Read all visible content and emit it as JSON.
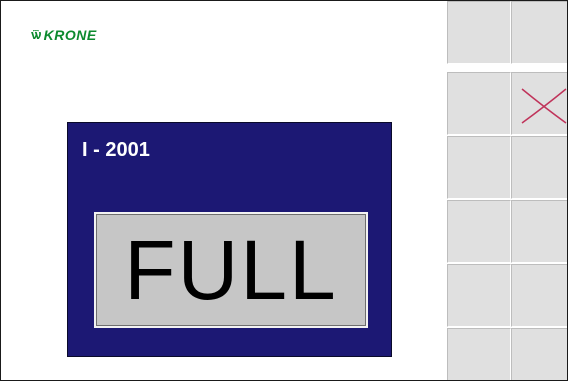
{
  "brand": {
    "logo_text": "KRONE",
    "logo_mark": "ѿ"
  },
  "alarm": {
    "code": "I - 2001",
    "status": "FULL"
  },
  "softkeys": [
    {
      "id": "key-1",
      "icon": ""
    },
    {
      "id": "key-2",
      "icon": ""
    },
    {
      "id": "key-3",
      "icon": ""
    },
    {
      "id": "key-4",
      "icon": "close-icon"
    },
    {
      "id": "key-5",
      "icon": ""
    },
    {
      "id": "key-6",
      "icon": ""
    },
    {
      "id": "key-7",
      "icon": ""
    },
    {
      "id": "key-8",
      "icon": ""
    },
    {
      "id": "key-9",
      "icon": ""
    },
    {
      "id": "key-10",
      "icon": ""
    },
    {
      "id": "key-11",
      "icon": ""
    },
    {
      "id": "key-12",
      "icon": ""
    }
  ],
  "colors": {
    "panel_bg": "#1c1874",
    "status_bg": "#c6c6c6",
    "logo_green": "#0c8a2e",
    "close_icon": "#c0335a",
    "softkey_bg": "#e0e0e0"
  }
}
